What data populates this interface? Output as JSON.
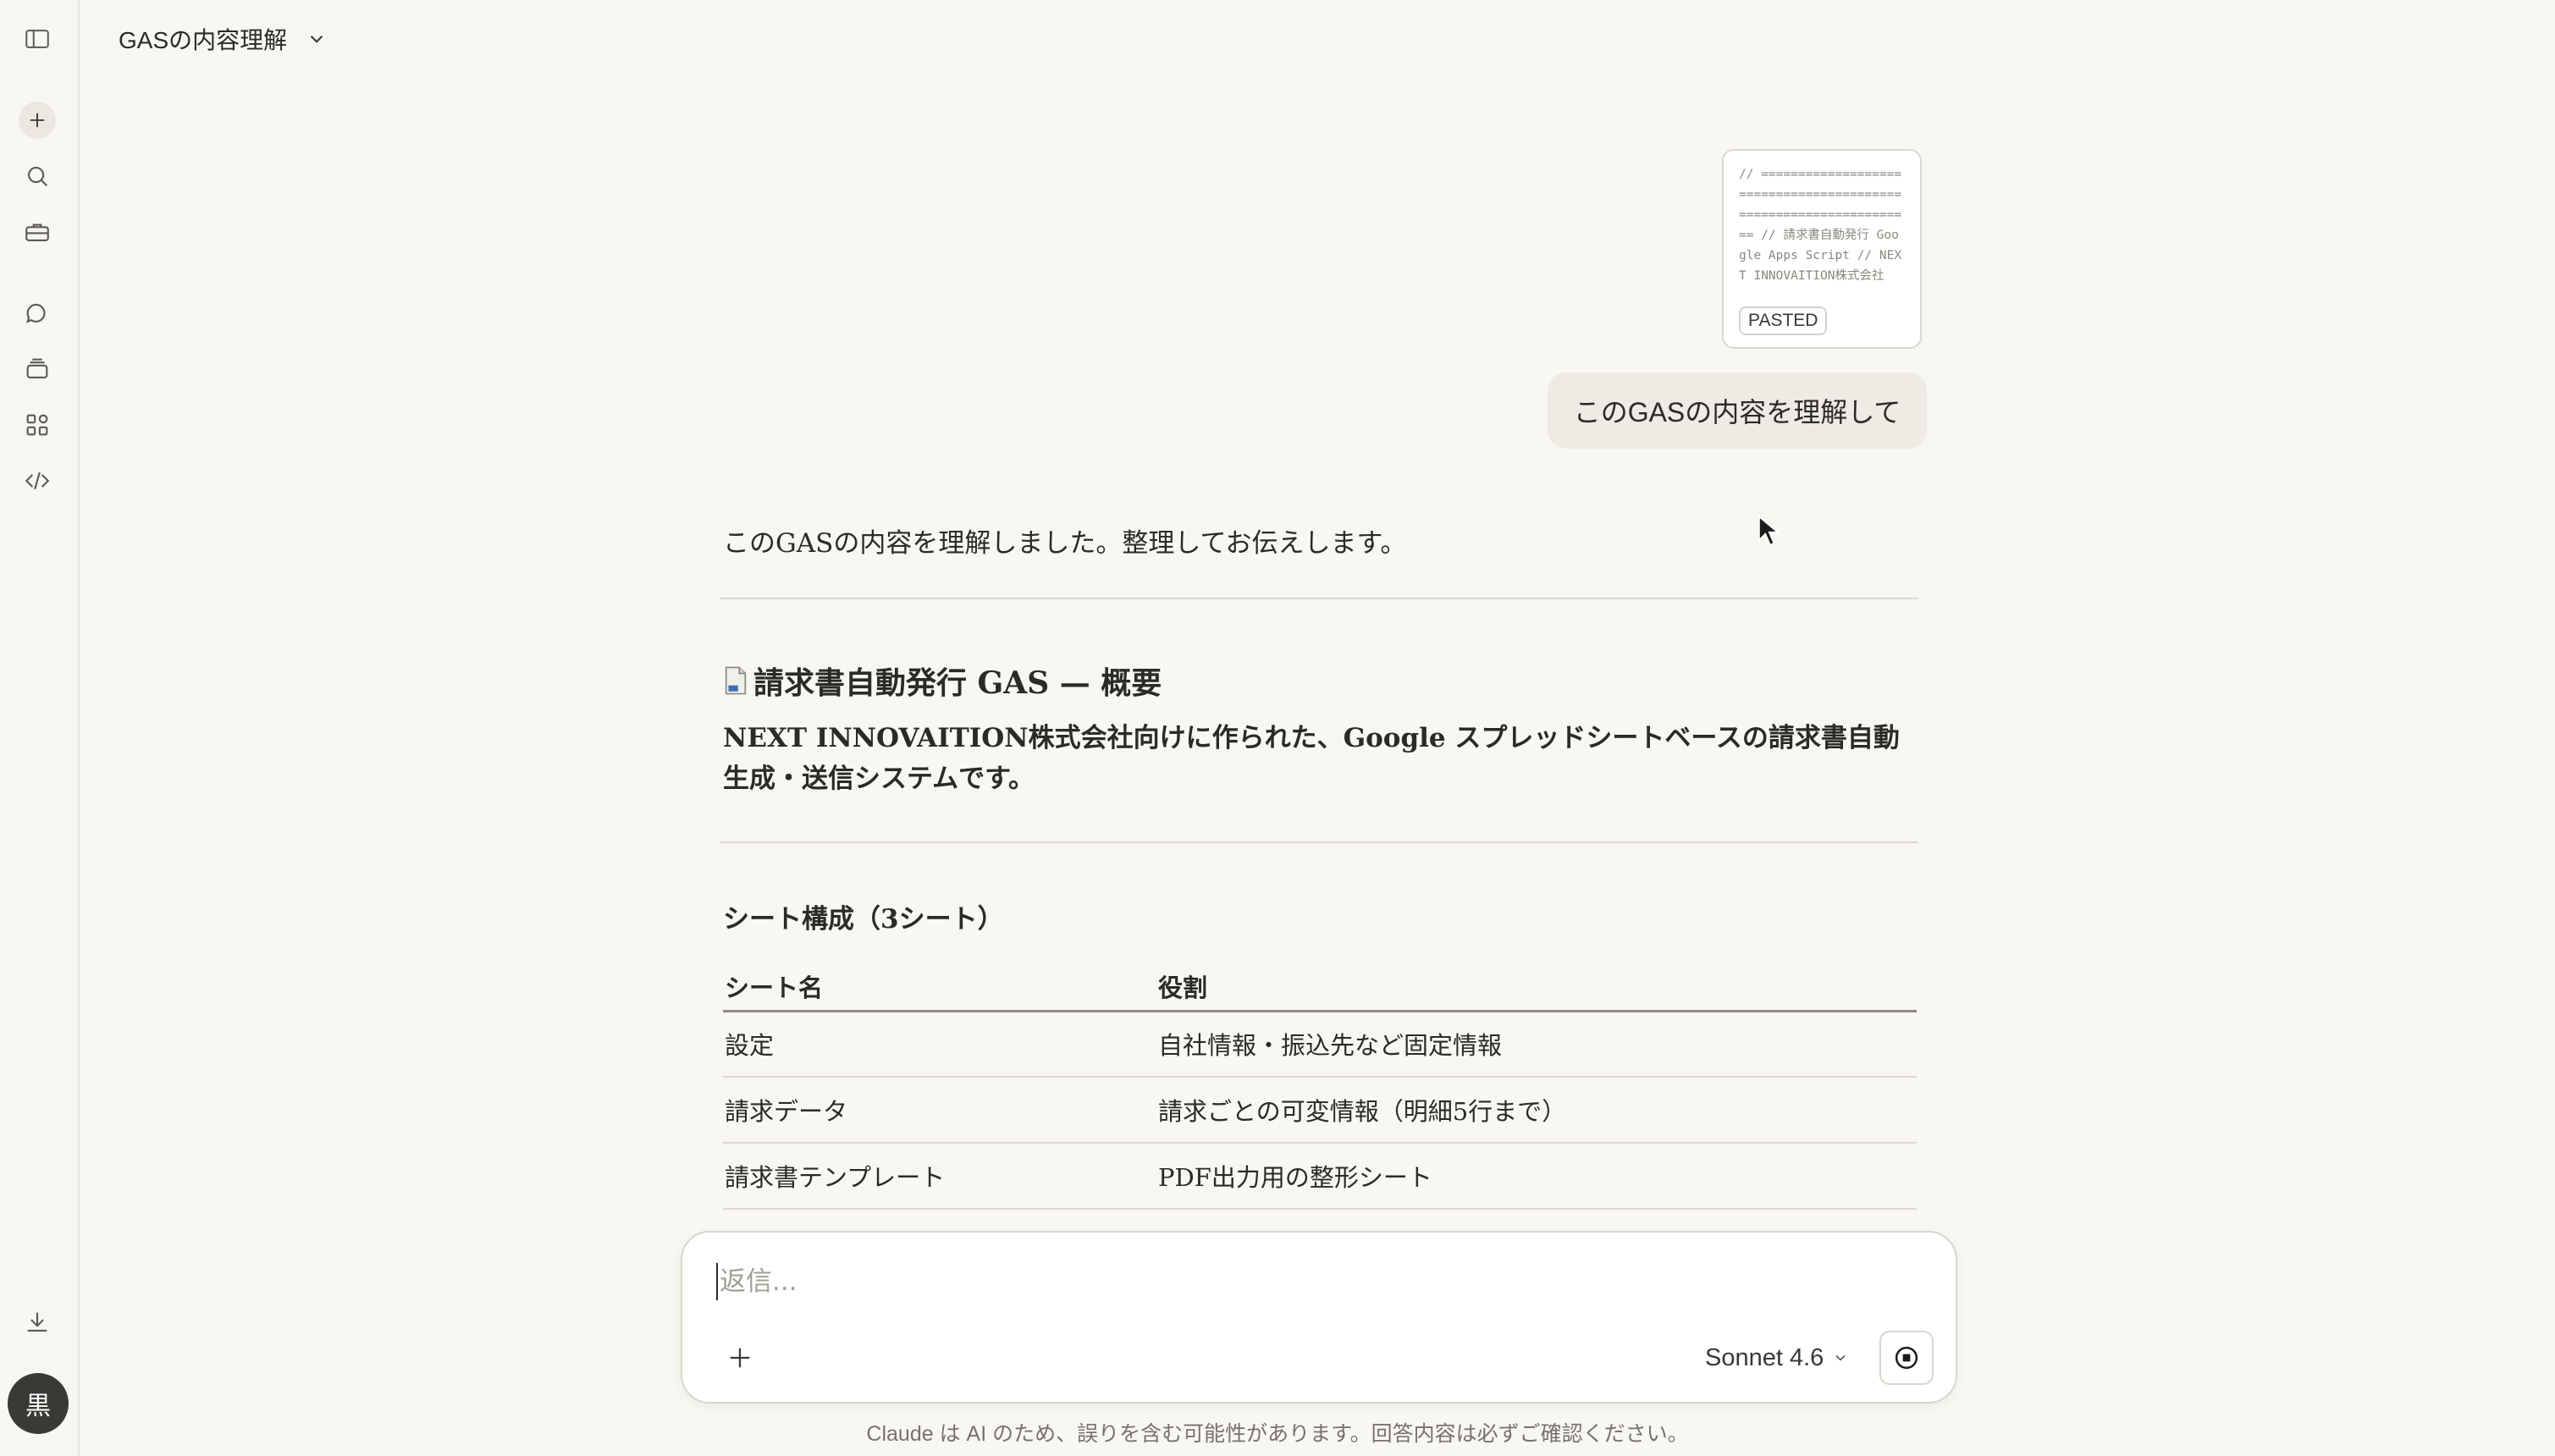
{
  "header": {
    "title": "GASの内容理解"
  },
  "sidebar": {
    "icons": [
      "sidebar-toggle-icon",
      "new-chat-icon",
      "search-icon",
      "toolbox-icon",
      "chats-icon",
      "projects-icon",
      "artifacts-icon",
      "code-icon",
      "download-icon"
    ],
    "avatar_initial": "黒"
  },
  "conversation": {
    "pasted": {
      "preview": "// ================================================================= // 請求書自動発行 Google Apps Script // NEXT INNOVAITION株式会社 /...",
      "badge": "PASTED"
    },
    "user_message": "このGASの内容を理解して",
    "assistant": {
      "intro": "このGASの内容を理解しました。整理してお伝えします。",
      "heading": "請求書自動発行 GAS — 概要",
      "summary": "NEXT INNOVAITION株式会社向けに作られた、Google スプレッドシートベースの請求書自動生成・送信システムです。",
      "sheets_heading": "シート構成（3シート）",
      "table": {
        "headers": [
          "シート名",
          "役割"
        ],
        "rows": [
          [
            "設定",
            "自社情報・振込先など固定情報"
          ],
          [
            "請求データ",
            "請求ごとの可変情報（明細5行まで）"
          ],
          [
            "請求書テンプレート",
            "PDF出力用の整形シート"
          ]
        ]
      }
    }
  },
  "composer": {
    "placeholder": "返信...",
    "model": "Sonnet 4.6"
  },
  "footer": {
    "disclaimer": "Claude は AI のため、誤りを含む可能性があります。回答内容は必ずご確認ください。"
  },
  "colors": {
    "background": "#f8f7f4",
    "bubble": "#eeebe5",
    "text": "#2b2a27"
  }
}
